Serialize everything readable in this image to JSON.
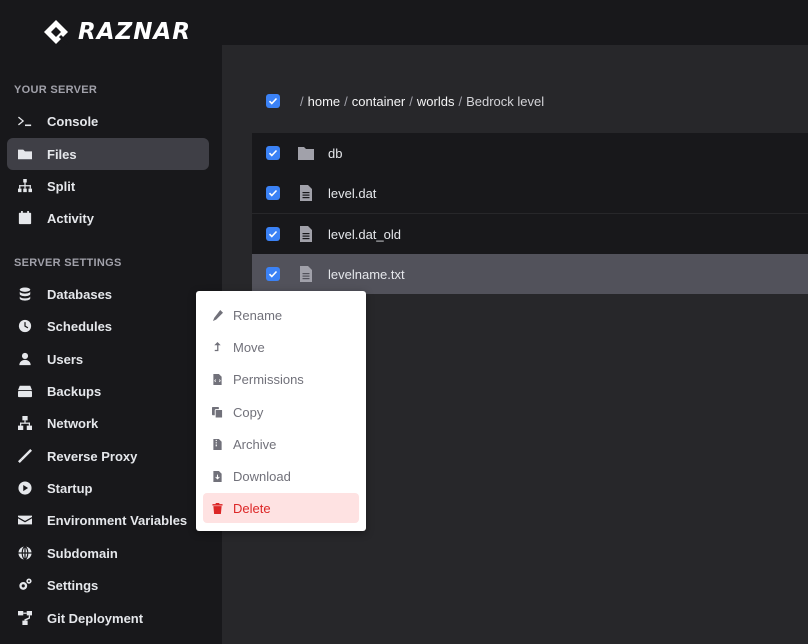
{
  "brand": {
    "name": "RAZNAR"
  },
  "sidebar": {
    "sections": [
      {
        "title": "YOUR SERVER"
      },
      {
        "title": "SERVER SETTINGS"
      }
    ],
    "items": [
      {
        "label": "Console",
        "icon": "terminal-icon"
      },
      {
        "label": "Files",
        "icon": "folder-icon",
        "active": true
      },
      {
        "label": "Split",
        "icon": "sitemap-icon"
      },
      {
        "label": "Activity",
        "icon": "calendar-icon"
      },
      {
        "label": "Databases",
        "icon": "database-icon"
      },
      {
        "label": "Schedules",
        "icon": "clock-icon"
      },
      {
        "label": "Users",
        "icon": "user-icon"
      },
      {
        "label": "Backups",
        "icon": "archive-box-icon"
      },
      {
        "label": "Network",
        "icon": "network-icon"
      },
      {
        "label": "Reverse Proxy",
        "icon": "wand-icon"
      },
      {
        "label": "Startup",
        "icon": "play-icon"
      },
      {
        "label": "Environment Variables",
        "icon": "envelope-icon"
      },
      {
        "label": "Subdomain",
        "icon": "globe-icon"
      },
      {
        "label": "Settings",
        "icon": "gears-icon"
      },
      {
        "label": "Git Deployment",
        "icon": "git-icon"
      }
    ]
  },
  "breadcrumb": {
    "segments": [
      "home",
      "container",
      "worlds",
      "Bedrock level"
    ]
  },
  "files": [
    {
      "name": "db",
      "type": "folder",
      "icon": "folder-icon"
    },
    {
      "name": "level.dat",
      "type": "file",
      "icon": "file-text-icon"
    },
    {
      "name": "level.dat_old",
      "type": "file",
      "icon": "file-text-icon"
    },
    {
      "name": "levelname.txt",
      "type": "file",
      "icon": "file-text-icon",
      "selected": true
    }
  ],
  "context_menu": {
    "items": [
      {
        "label": "Rename",
        "icon": "pencil-icon"
      },
      {
        "label": "Move",
        "icon": "move-arrow-icon"
      },
      {
        "label": "Permissions",
        "icon": "file-code-icon"
      },
      {
        "label": "Copy",
        "icon": "copy-icon"
      },
      {
        "label": "Archive",
        "icon": "file-archive-icon"
      },
      {
        "label": "Download",
        "icon": "file-download-icon"
      },
      {
        "label": "Delete",
        "icon": "trash-icon",
        "danger": true
      }
    ]
  },
  "colors": {
    "accent": "#3b82f6",
    "danger": "#dc2626",
    "sidebar_bg": "#18181b",
    "main_bg": "#27272a"
  }
}
